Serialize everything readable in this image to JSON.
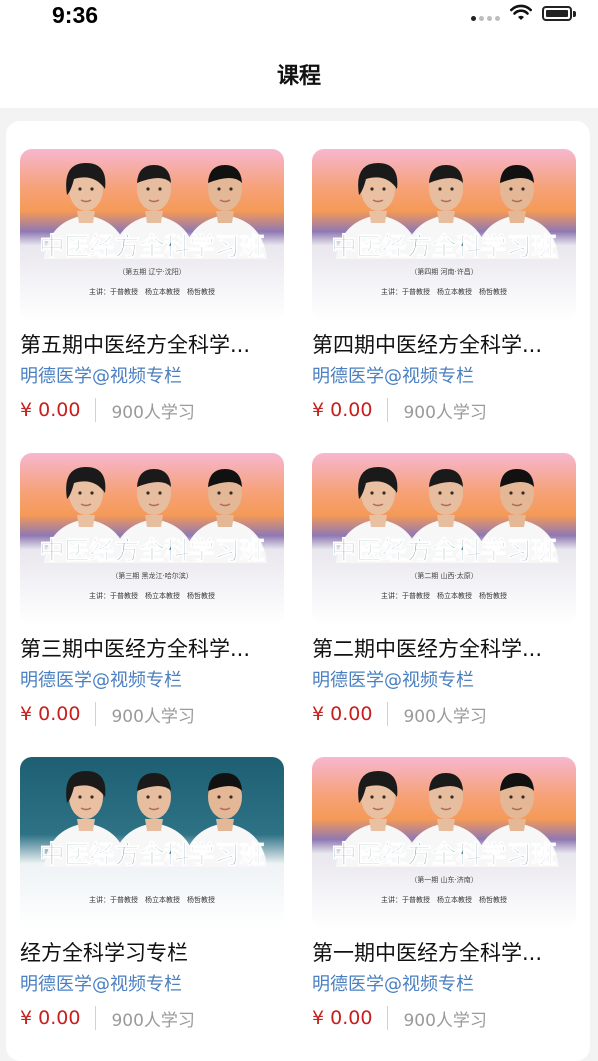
{
  "status": {
    "time": "9:36"
  },
  "header": {
    "title": "课程"
  },
  "poster": {
    "main_title": "中医经方全科学习班",
    "teachers": "主讲：于普教授　杨立本教授　杨哲教授"
  },
  "courses": [
    {
      "title": "第五期中医经方全科学...",
      "author": "明德医学@视频专栏",
      "price": "¥ 0.00",
      "learners": "900人学习",
      "poster_sub": "（第五期 辽宁·沈阳）",
      "bg": "sunset"
    },
    {
      "title": "第四期中医经方全科学...",
      "author": "明德医学@视频专栏",
      "price": "¥ 0.00",
      "learners": "900人学习",
      "poster_sub": "（第四期 河南·许昌）",
      "bg": "sunset"
    },
    {
      "title": "第三期中医经方全科学...",
      "author": "明德医学@视频专栏",
      "price": "¥ 0.00",
      "learners": "900人学习",
      "poster_sub": "（第三期 黑龙江·哈尔滨）",
      "bg": "sunset"
    },
    {
      "title": "第二期中医经方全科学...",
      "author": "明德医学@视频专栏",
      "price": "¥ 0.00",
      "learners": "900人学习",
      "poster_sub": "（第二期 山西·太原）",
      "bg": "sunset"
    },
    {
      "title": "经方全科学习专栏",
      "author": "明德医学@视频专栏",
      "price": "¥ 0.00",
      "learners": "900人学习",
      "poster_sub": "",
      "bg": "teal"
    },
    {
      "title": "第一期中医经方全科学...",
      "author": "明德医学@视频专栏",
      "price": "¥ 0.00",
      "learners": "900人学习",
      "poster_sub": "（第一期 山东·济南）",
      "bg": "sunset"
    }
  ],
  "colors": {
    "price": "#c8201e",
    "author": "#4a7fc0",
    "poster_title": "#1f5b7a"
  },
  "icons": [
    "signal-icon",
    "wifi-icon",
    "battery-icon"
  ]
}
